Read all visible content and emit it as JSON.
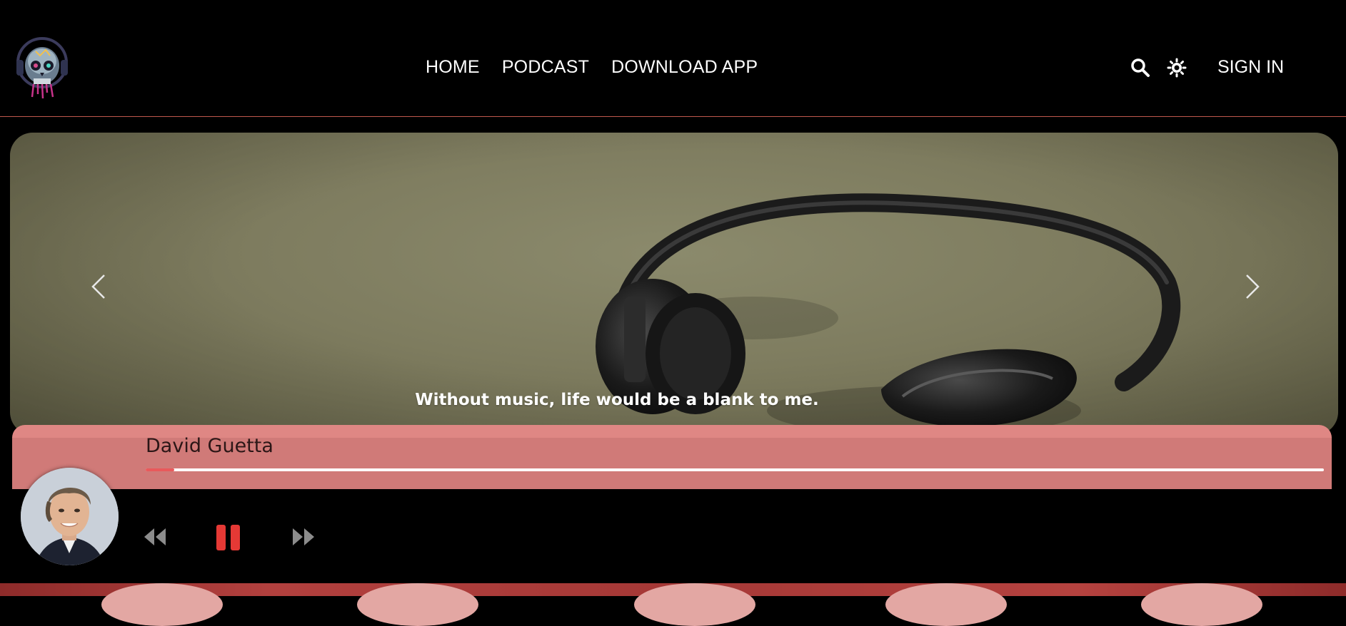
{
  "header": {
    "nav": [
      "HOME",
      "PODCAST",
      "DOWNLOAD APP"
    ],
    "sign_in": "SIGN IN"
  },
  "hero": {
    "caption": "Without music, life would be a blank to me."
  },
  "player": {
    "artist": "David Guetta",
    "progress_fraction": 0.024,
    "colors": {
      "bar": "#d07a78",
      "progress": "#e9595b",
      "pause": "#e53935"
    }
  },
  "icons": [
    "logo-skull-icon",
    "search-icon",
    "theme-toggle-icon",
    "chevron-left-icon",
    "chevron-right-icon",
    "rewind-icon",
    "pause-icon",
    "fast-forward-icon"
  ]
}
